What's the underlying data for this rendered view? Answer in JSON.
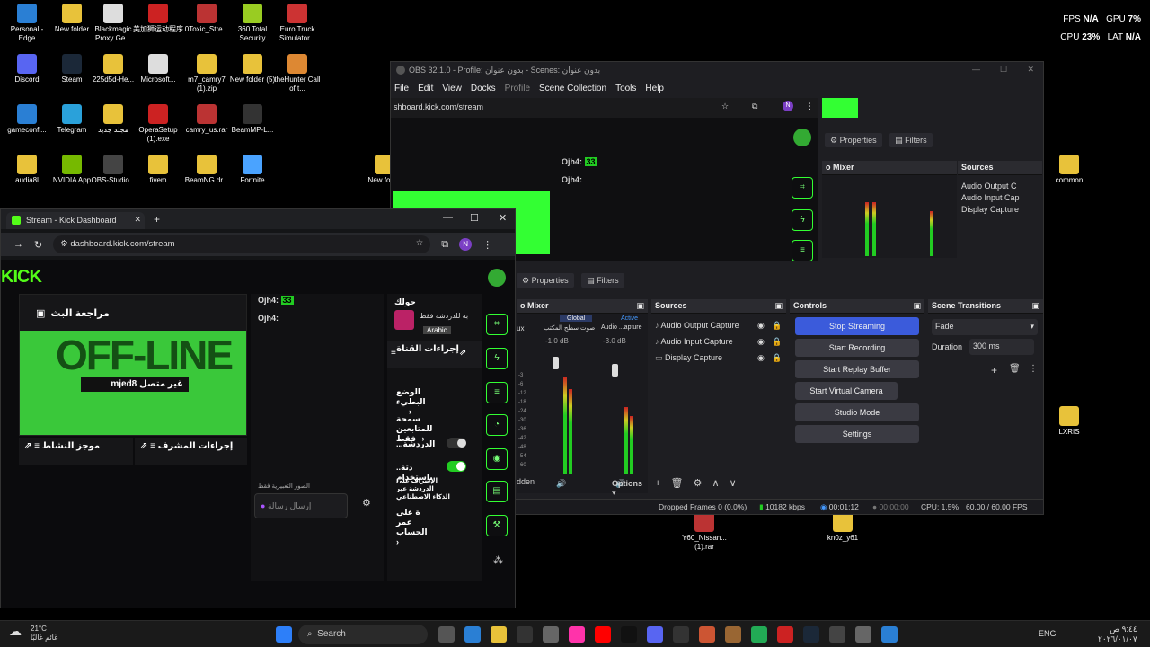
{
  "desktop_icons": [
    {
      "label": "Personal - Edge",
      "color": "#2a7fd4"
    },
    {
      "label": "New folder",
      "color": "#e8c23a"
    },
    {
      "label": "Blackmagic Proxy Ge...",
      "color": "#ddd"
    },
    {
      "label": "美加狮运动程序",
      "color": "#c22"
    },
    {
      "label": "0Toxic_Stre...",
      "color": "#b33"
    },
    {
      "label": "360 Total Security",
      "color": "#9c2"
    },
    {
      "label": "Euro Truck Simulator...",
      "color": "#c33"
    },
    {
      "label": "Discord",
      "color": "#5865f2"
    },
    {
      "label": "Steam",
      "color": "#1b2838"
    },
    {
      "label": "225d5d-He...",
      "color": "#e8c23a"
    },
    {
      "label": "Microsoft...",
      "color": "#ddd"
    },
    {
      "label": "m7_camry7 (1).zip",
      "color": "#e8c23a"
    },
    {
      "label": "New folder (5)",
      "color": "#e8c23a"
    },
    {
      "label": "theHunter Call of t...",
      "color": "#d83"
    },
    {
      "label": "gameconfi...",
      "color": "#2a7fd4"
    },
    {
      "label": "Telegram",
      "color": "#2aa1da"
    },
    {
      "label": "مجلد جديد",
      "color": "#e8c23a"
    },
    {
      "label": "OperaSetup (1).exe",
      "color": "#c22"
    },
    {
      "label": "camry_us.rar",
      "color": "#b33"
    },
    {
      "label": "BeamMP-L...",
      "color": "#333"
    },
    {
      "label": "audia8l",
      "color": "#e8c23a"
    },
    {
      "label": "NVIDIA App",
      "color": "#76b900"
    },
    {
      "label": "OBS-Studio...",
      "color": "#444"
    },
    {
      "label": "fivem",
      "color": "#e8c23a"
    },
    {
      "label": "BeamNG.dr...",
      "color": "#e8c23a"
    },
    {
      "label": "Fortnite",
      "color": "#4aa3ff"
    },
    {
      "label": "New fo (3)",
      "color": "#e8c23a"
    },
    {
      "label": "common",
      "color": "#e8c23a"
    },
    {
      "label": "LXRIS",
      "color": "#e8c23a"
    },
    {
      "label": "Y60_Nissan... (1).rar",
      "color": "#b33"
    },
    {
      "label": "kn0z_y61",
      "color": "#e8c23a"
    }
  ],
  "perf": {
    "fps_label": "FPS",
    "fps": "N/A",
    "gpu_label": "GPU",
    "gpu": "7%",
    "cpu_label": "CPU",
    "cpu": "23%",
    "lat_label": "LAT",
    "lat": "N/A"
  },
  "obs": {
    "title": "OBS 32.1.0 - Profile: بدون عنوان - Scenes: بدون عنوان",
    "menu": [
      "File",
      "Edit",
      "View",
      "Docks",
      "Profile",
      "Scene Collection",
      "Tools",
      "Help"
    ],
    "browser_url": "shboard.kick.com/stream",
    "properties_label": "Properties",
    "filters_label": "Filters",
    "mixer_title": "o Mixer",
    "mixer_global": "Global",
    "mixer_active": "Active",
    "mixer_ch1": "ux",
    "mixer_ch2": "صوت سطح المكتب",
    "mixer_ch3": "Audio ...apture",
    "mixer_db1": "-1.0 dB",
    "mixer_db2": "-3.0 dB",
    "meter_scale": [
      "-3",
      "-6",
      "-12",
      "-18",
      "-24",
      "-30",
      "-36",
      "-42",
      "-48",
      "-54",
      "-60"
    ],
    "sources_title": "Sources",
    "sources": [
      "Audio Output Capture",
      "Audio Input Capture",
      "Display Capture"
    ],
    "controls_title": "Controls",
    "controls": [
      "Stop Streaming",
      "Start Recording",
      "Start Replay Buffer",
      "Start Virtual Camera",
      "Studio Mode",
      "Settings"
    ],
    "transitions_title": "Scene Transitions",
    "transition": "Fade",
    "duration_label": "Duration",
    "duration": "300 ms",
    "hidden_label": "dden",
    "options_label": "Options",
    "status": {
      "dropped": "Dropped Frames 0 (0.0%)",
      "kbps": "10182 kbps",
      "time1": "00:01:12",
      "time2": "00:00:00",
      "cpu": "CPU: 1.5%",
      "fps": "60.00 / 60.00 FPS"
    },
    "bg_sources": [
      "Audio Output C",
      "Audio Input Cap",
      "Display Capture"
    ]
  },
  "kick": {
    "tab_title": "Stream - Kick Dashboard",
    "url": "dashboard.kick.com/stream",
    "logo": "KICK",
    "profile_letter": "N",
    "stream_review": "مراجعة البث",
    "offline_badge": "غير متصل",
    "channel": "mjed8 غير متصل",
    "offline_art": "OFF-LINE",
    "chat_user1": "Ojh4:",
    "chat_user1_badge": "33",
    "chat_user2": "Ojh4:",
    "about": "حولك",
    "chat_room_note": "بة للدردشة فقط",
    "language_tag": "Arabic",
    "channel_actions": "إجراءات القناة",
    "active_feed": "موجز النشاط",
    "mod_actions": "إجراءات المشرف",
    "slow_mode": "الوضع البطيء",
    "followers_only": "سمحة للمتابعين فقط",
    "chat_toggle": "...الدردشة",
    "chat_usage": "..دثة باستخدام",
    "ai_moderation": "الإشراف على الدردشة عبر الذكاء الاصطناعي",
    "account_age": "ة على عمر الحساب",
    "emotes_only": "الصور التعبيرية فقط",
    "send_placeholder": "إرسال رسالة"
  },
  "taskbar": {
    "weather_temp": "21°C",
    "weather_desc": "غائم غالبًا",
    "search": "Search",
    "lang": "ENG",
    "time": "٩:٤٤ ص",
    "date": "٢٠٢٦/٠١/٠٧"
  }
}
